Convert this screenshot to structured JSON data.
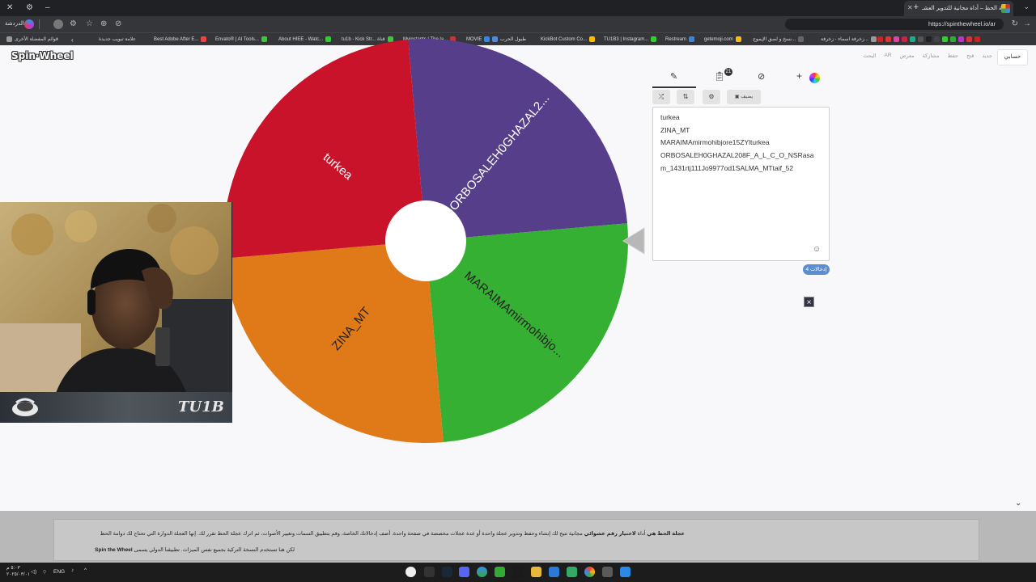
{
  "browser": {
    "active_tab_title": "عجلة الحظ – أداة مجانية للتدوير العشـ",
    "url": "https://spinthewheel.io/ar",
    "bookmarks": [
      {
        "label": "قوائم المفضلة الأخرى",
        "color": "#999"
      },
      {
        "label": "علامة تبويب جديدة",
        "color": "#777"
      },
      {
        "label": "Best Adobe After E...",
        "color": "#e44"
      },
      {
        "label": "Envato® | AI Tools...",
        "color": "#3c3"
      },
      {
        "label": "About HIEE - Watc...",
        "color": "#3c3"
      },
      {
        "label": "tu1b - Kick Str... قناة",
        "color": "#3c3"
      },
      {
        "label": "Myinstants | The la...",
        "color": "#c33"
      },
      {
        "label": "MOVIE",
        "color": "#38d"
      },
      {
        "label": "طبول الحرب",
        "color": "#58d"
      },
      {
        "label": "KickBot Custom Co...",
        "color": "#fb0"
      },
      {
        "label": "TU1B3 | Instagram...",
        "color": "#3c3"
      },
      {
        "label": "Restream",
        "color": "#38d"
      },
      {
        "label": "getemoji.com",
        "color": "#fb0"
      },
      {
        "label": "نسخ و لصق الإيموج...",
        "color": "#666"
      },
      {
        "label": "زخرفة اسماء - زخرفة...",
        "color": "#999"
      }
    ]
  },
  "site": {
    "logo": "Spin·Wheel",
    "user_button": "حسابي",
    "nav": [
      "جديد",
      "فتح",
      "حفظ",
      "مشاركة",
      "معرض",
      "AR",
      "البحث"
    ],
    "editor": {
      "tab_edit_icon": "pencil-icon",
      "tab_results_icon": "clipboard-icon",
      "tab_results_count": "21",
      "tab_hide_icon": "eye-off-icon",
      "add_label": "+",
      "shuffle_icon": "shuffle-icon",
      "sort_icon": "sort-icon",
      "settings_icon": "gear-icon",
      "image_button_label": "يضيف",
      "entries": [
        "turkea",
        "ZINA_MT",
        "MARAIMAmirmohibjore15ZYlturkea",
        "ORBOSALEH0GHAZAL208F_A_L_C_O_NSRasa",
        "m_1431rtj111Jo9977od1SALMA_MTtaif_52"
      ],
      "entry_count_label": "إدخالات 4",
      "emoji_icon": "smiley-icon"
    },
    "wheel": {
      "slices": [
        {
          "label": "ORBOSALEH0GHAZAL2...",
          "color": "#573e8a",
          "start": 0,
          "end": 90,
          "text_color": "#ffffff"
        },
        {
          "label": "MARAIMAmirmohibjo...",
          "color": "#36b032",
          "start": 90,
          "end": 180,
          "text_color": "#222222"
        },
        {
          "label": "ZINA_MT",
          "color": "#e07a18",
          "start": 180,
          "end": 270,
          "text_color": "#222222"
        },
        {
          "label": "turkea",
          "color": "#c8132a",
          "start": 270,
          "end": 360,
          "text_color": "#ffffff"
        }
      ],
      "rotation_deg": -5
    },
    "description": {
      "line1_bold": "عجلة الحظ هي",
      "line1_text": " أداة ",
      "line1_bold2": "لاختيار رقم عشوائي",
      "line1_rest": " مجانية تتيح لك إنشاء وحفظ وتدوير عجلة واحدة أو عدة عجلات مخصصة في صفحة واحدة. أضف إدخالاتك الخاصة، وقم بتطبيق السمات وتغيير الأصوات، ثم اترك عجلة الحظ تقرر لك. إنها العجلة الدوارة التي تحتاج لك دوامة الحظ",
      "line2_text": "لكن هنا تستخدم النسخة التركية بجميع نفس الميزات. تطبيقنا الدولي يسمى ",
      "line2_bold": "Spin the Wheel"
    }
  },
  "webcam": {
    "brand": "TU1B"
  },
  "taskbar": {
    "lang": "ENG",
    "time": "٥:٠٣ م",
    "date": "٢٠٢٥/٠٣/٠١"
  }
}
